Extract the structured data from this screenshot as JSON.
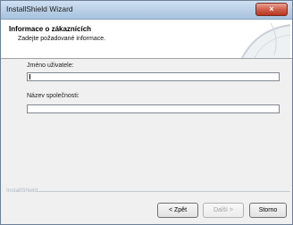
{
  "window": {
    "title": "InstallShield Wizard",
    "close_label": "×"
  },
  "header": {
    "title": "Informace o zákaznících",
    "subtitle": "Zadejte požadované informace."
  },
  "form": {
    "username_label": "Jméno uživatele:",
    "username_value": "",
    "company_label": "Název společnosti:",
    "company_value": ""
  },
  "footer": {
    "brand": "InstallShield"
  },
  "buttons": {
    "back": "< Zpět",
    "next": "Další >",
    "cancel": "Storno"
  },
  "colors": {
    "titlebar": "#b9cfe6",
    "close": "#cf5a45"
  }
}
